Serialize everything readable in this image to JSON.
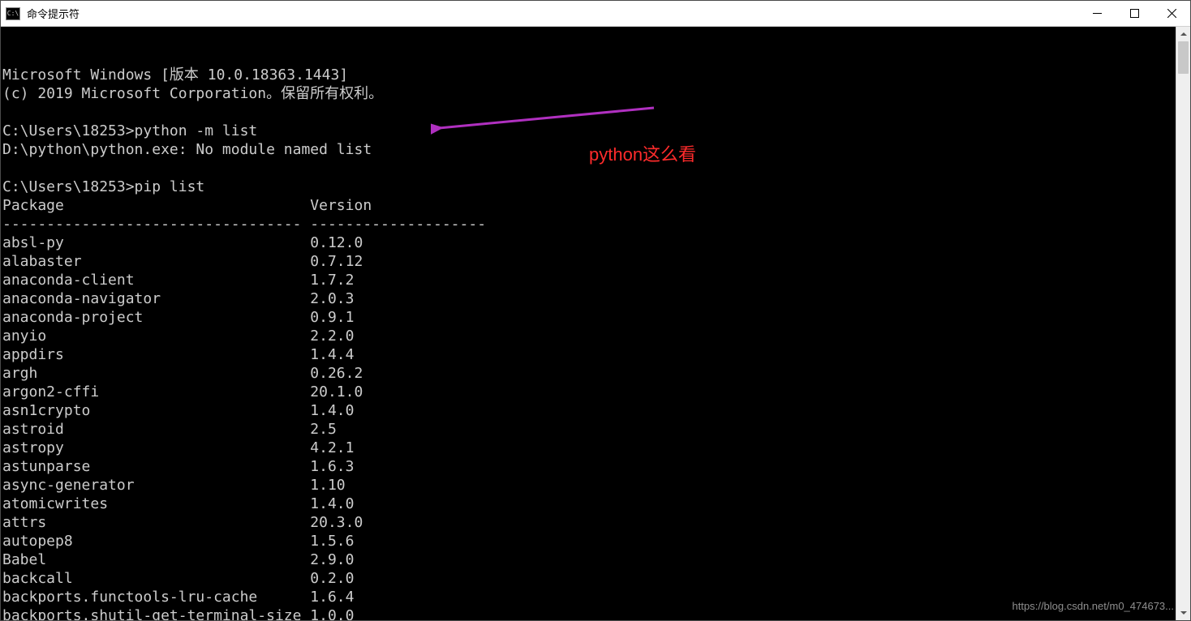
{
  "window": {
    "title": "命令提示符"
  },
  "terminal": {
    "banner_line1": "Microsoft Windows [版本 10.0.18363.1443]",
    "banner_line2": "(c) 2019 Microsoft Corporation。保留所有权利。",
    "prompt1_path": "C:\\Users\\18253>",
    "prompt1_cmd": "python -m list",
    "error_line": "D:\\python\\python.exe: No module named list",
    "prompt2_path": "C:\\Users\\18253>",
    "prompt2_cmd": "pip list",
    "header_package": "Package",
    "header_version": "Version",
    "packages": [
      {
        "name": "absl-py",
        "version": "0.12.0"
      },
      {
        "name": "alabaster",
        "version": "0.7.12"
      },
      {
        "name": "anaconda-client",
        "version": "1.7.2"
      },
      {
        "name": "anaconda-navigator",
        "version": "2.0.3"
      },
      {
        "name": "anaconda-project",
        "version": "0.9.1"
      },
      {
        "name": "anyio",
        "version": "2.2.0"
      },
      {
        "name": "appdirs",
        "version": "1.4.4"
      },
      {
        "name": "argh",
        "version": "0.26.2"
      },
      {
        "name": "argon2-cffi",
        "version": "20.1.0"
      },
      {
        "name": "asn1crypto",
        "version": "1.4.0"
      },
      {
        "name": "astroid",
        "version": "2.5"
      },
      {
        "name": "astropy",
        "version": "4.2.1"
      },
      {
        "name": "astunparse",
        "version": "1.6.3"
      },
      {
        "name": "async-generator",
        "version": "1.10"
      },
      {
        "name": "atomicwrites",
        "version": "1.4.0"
      },
      {
        "name": "attrs",
        "version": "20.3.0"
      },
      {
        "name": "autopep8",
        "version": "1.5.6"
      },
      {
        "name": "Babel",
        "version": "2.9.0"
      },
      {
        "name": "backcall",
        "version": "0.2.0"
      },
      {
        "name": "backports.functools-lru-cache",
        "version": "1.6.4"
      },
      {
        "name": "backports.shutil-get-terminal-size",
        "version": "1.0.0"
      }
    ],
    "col1_width": 35,
    "col2_start": 35
  },
  "annotation": {
    "text": "python这么看"
  },
  "watermark": "https://blog.csdn.net/m0_474673..."
}
